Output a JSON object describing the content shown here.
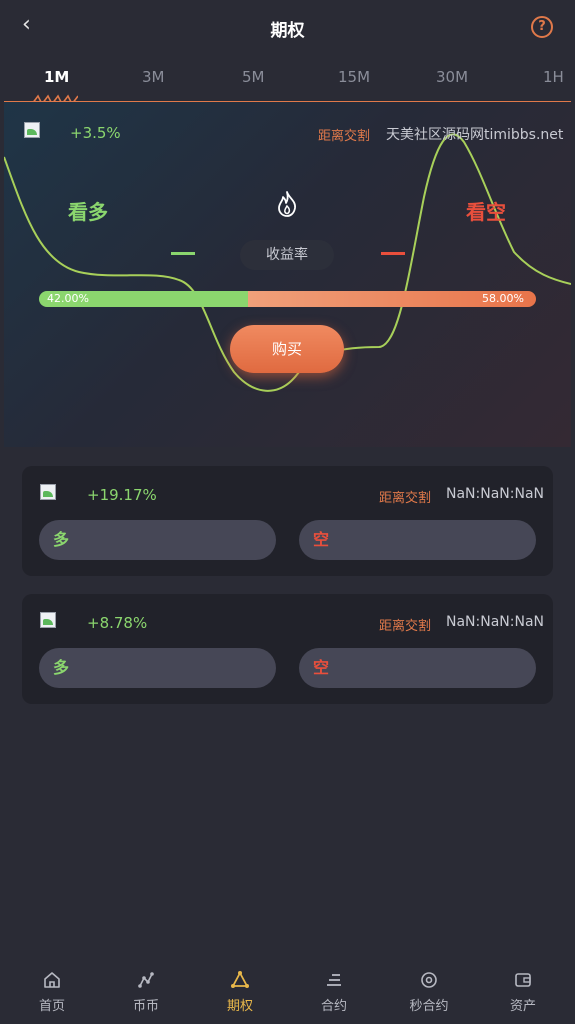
{
  "header": {
    "back_icon": "chevron-left-icon",
    "title": "期权",
    "help_icon": "question-circle-icon",
    "help_label": "?"
  },
  "tabs": [
    {
      "label": "1M",
      "active": true
    },
    {
      "label": "3M",
      "active": false
    },
    {
      "label": "5M",
      "active": false
    },
    {
      "label": "15M",
      "active": false
    },
    {
      "label": "30M",
      "active": false
    },
    {
      "label": "1H",
      "active": false
    }
  ],
  "main": {
    "change": "+3.5%",
    "settle_label": "距离交割",
    "settle_value": "天美社区源码网timibbs.net",
    "look_long": "看多",
    "look_short": "看空",
    "yield_label": "收益率",
    "long_ratio": 0.42,
    "long_pct": "42.00%",
    "short_pct": "58.00%",
    "buy_label": "购买",
    "fire_icon": "fire-icon"
  },
  "cards": [
    {
      "change": "+19.17%",
      "settle_label": "距离交割",
      "settle_value": "NaN:NaN:NaN",
      "long_label": "多",
      "short_label": "空"
    },
    {
      "change": "+8.78%",
      "settle_label": "距离交割",
      "settle_value": "NaN:NaN:NaN",
      "long_label": "多",
      "short_label": "空"
    }
  ],
  "nav": [
    {
      "label": "首页",
      "icon": "home-icon",
      "active": false
    },
    {
      "label": "币币",
      "icon": "coin-trade-icon",
      "active": false
    },
    {
      "label": "期权",
      "icon": "option-icon",
      "active": true
    },
    {
      "label": "合约",
      "icon": "contract-icon",
      "active": false
    },
    {
      "label": "秒合约",
      "icon": "second-contract-icon",
      "active": false
    },
    {
      "label": "资产",
      "icon": "wallet-icon",
      "active": false
    }
  ],
  "colors": {
    "accent": "#e0794a",
    "up": "#8bd66e",
    "down": "#e94f3c",
    "nav_active": "#e9b84a",
    "background": "#2a2b35"
  }
}
